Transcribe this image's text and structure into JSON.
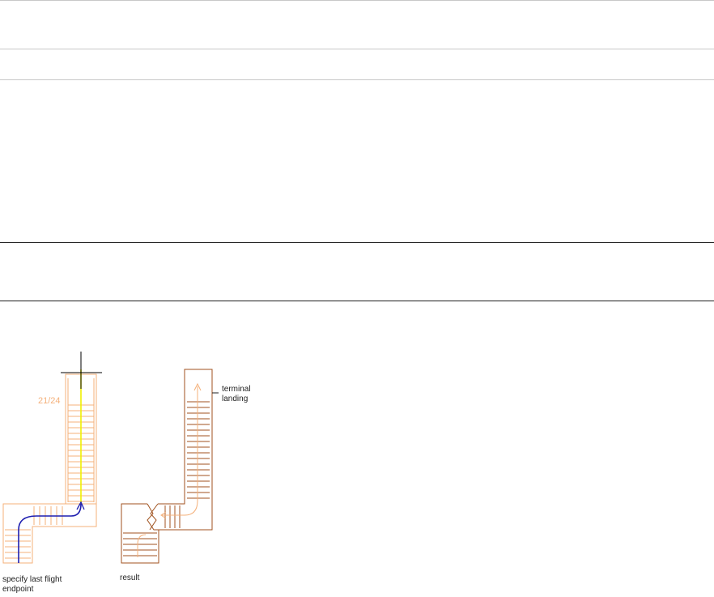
{
  "figure": {
    "left_stair": {
      "step_counter": "21/24",
      "caption_line1": "specify last flight",
      "caption_line2": "endpoint"
    },
    "right_stair": {
      "callout_line1": "terminal",
      "callout_line2": "landing",
      "caption": "result"
    }
  },
  "colors": {
    "stair_outline": "#f4b07a",
    "stair_outline_result": "#a0521f",
    "path_line": "#1f1fb0",
    "yellow_guide": "#f0f000",
    "rule_light": "#c8c8c8",
    "rule_dark": "#1e1e1e",
    "crosshair": "#000000"
  }
}
